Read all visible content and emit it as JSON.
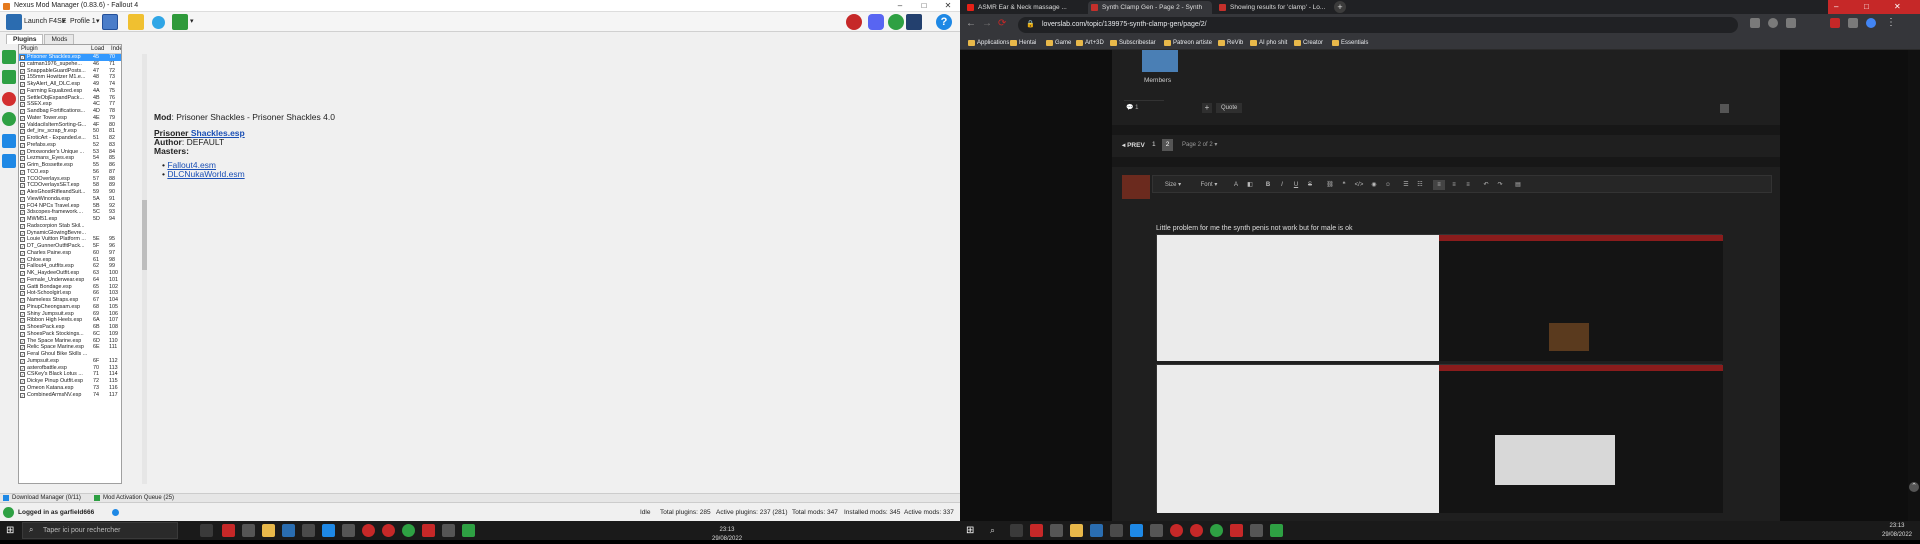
{
  "nmm": {
    "title": "Nexus Mod Manager (0.83.6) - Fallout 4",
    "toolbar": {
      "launch": "Launch F4SE",
      "profile": "Profile 1"
    },
    "tabs": [
      "Plugins",
      "Mods"
    ],
    "columns": {
      "plugin": "Plugin",
      "load_order": "Load Order",
      "index": "Index"
    },
    "plugins": [
      [
        "Prisoner Shackles.esp",
        "45",
        "70"
      ],
      [
        "catman1976_supehe...",
        "46",
        "71"
      ],
      [
        "SnappableGuardPosts...",
        "47",
        "72"
      ],
      [
        "155mm Howitzer M1.e...",
        "48",
        "73"
      ],
      [
        "SkyAlert_All_DLC.esp",
        "49",
        "74"
      ],
      [
        "Farming Equalized.esp",
        "4A",
        "75"
      ],
      [
        "SettleObjExpandPack...",
        "4B",
        "76"
      ],
      [
        "SSEX.esp",
        "4C",
        "77"
      ],
      [
        "Sandbag Fortifications...",
        "4D",
        "78"
      ],
      [
        "Water Tower.esp",
        "4E",
        "79"
      ],
      [
        "ValdacilsItemSorting-G...",
        "4F",
        "80"
      ],
      [
        "def_inv_scrap_fr.esp",
        "50",
        "81"
      ],
      [
        "EroticArt - Expanded.e...",
        "51",
        "82"
      ],
      [
        "Prefabs.esp",
        "52",
        "83"
      ],
      [
        "Dmxwonder's Unique ...",
        "53",
        "84"
      ],
      [
        "Lezmans_Eyes.esp",
        "54",
        "85"
      ],
      [
        "Grim_Bossette.esp",
        "55",
        "86"
      ],
      [
        "TCO.esp",
        "56",
        "87"
      ],
      [
        "TCOOverlays.esp",
        "57",
        "88"
      ],
      [
        "TCDOverlaysSET.esp",
        "58",
        "89"
      ],
      [
        "AlexGhostRifleandSuit...",
        "59",
        "90"
      ],
      [
        "ViewWinonda.esp",
        "5A",
        "91"
      ],
      [
        "FO4 NPCs Travel.esp",
        "5B",
        "92"
      ],
      [
        "3dscopes-framework....",
        "5C",
        "93"
      ],
      [
        "MWM51.esp",
        "5D",
        "94"
      ],
      [
        "Radscorpion Stab Skil...",
        "",
        ""
      ],
      [
        "DynamicGlowingBevre...",
        "",
        ""
      ],
      [
        "Louie Vuitton Platform ...",
        "5E",
        "95"
      ],
      [
        "DT_GunnerOutfitPack...",
        "5F",
        "96"
      ],
      [
        "Charles Paine.esp",
        "60",
        "97"
      ],
      [
        "Chloe.esp",
        "61",
        "98"
      ],
      [
        "Fallout4_outfits.esp",
        "62",
        "99"
      ],
      [
        "NK_HaydeeOutfit.esp",
        "63",
        "100"
      ],
      [
        "Female_Underwear.esp",
        "64",
        "101"
      ],
      [
        "Gatti Bondage.esp",
        "65",
        "102"
      ],
      [
        "Hot-Schoolgirl.esp",
        "66",
        "103"
      ],
      [
        "Nameless Straps.esp",
        "67",
        "104"
      ],
      [
        "PinupCheongsam.esp",
        "68",
        "105"
      ],
      [
        "Shiny Jumpsuit.esp",
        "69",
        "106"
      ],
      [
        "Ribbon High Heels.esp",
        "6A",
        "107"
      ],
      [
        "ShoesPack.esp",
        "6B",
        "108"
      ],
      [
        "ShoesPack Stockings...",
        "6C",
        "109"
      ],
      [
        "The Space Marine.esp",
        "6D",
        "110"
      ],
      [
        "Relic Space Marine.esp",
        "6E",
        "111"
      ],
      [
        "Feral Ghoul Bike Skills ...",
        "",
        ""
      ],
      [
        "Jumpsuit.esp",
        "6F",
        "112"
      ],
      [
        "asterofbattle.esp",
        "70",
        "113"
      ],
      [
        "CSKey's Black Lotus ...",
        "71",
        "114"
      ],
      [
        "Dickye Pinup Outfit.esp",
        "72",
        "115"
      ],
      [
        "Omeon Katana.esp",
        "73",
        "116"
      ],
      [
        "CombinedArmsNV.esp",
        "74",
        "117"
      ]
    ],
    "detail": {
      "mod_label": "Mod",
      "mod_value": ": Prisoner Shackles - Prisoner Shackles 4.0",
      "file_plain": "Prisoner ",
      "file_link": "Shackles.esp",
      "author_label": "Author",
      "author_value": ": DEFAULT",
      "masters_label": "Masters",
      "masters": [
        "Fallout4.esm",
        "DLCNukaWorld.esm"
      ]
    },
    "queue": {
      "download": "Download Manager (0/11)",
      "activation": "Mod Activation Queue (25)"
    },
    "status": {
      "login": "Logged in as garfield666",
      "state": "Idle",
      "total_plugins": "Total plugins: 285",
      "active_plugins": "Active plugins:  237 (281)",
      "total_mods": "Total mods: 347",
      "installed_mods": "Installed mods: 345",
      "active_mods": "Active mods: 337"
    }
  },
  "browser": {
    "tabs": [
      "ASMR Ear & Neck massage ...",
      "Synth Clamp Gen - Page 2 - Synth",
      "Showing results for 'clamp' - Lo..."
    ],
    "url": "loverslab.com/topic/139975-synth-clamp-gen/page/2/",
    "bookmarks": [
      "Applications",
      "Hentai",
      "Game",
      "Art+3D",
      "Subscribestar",
      "Patreon artiste",
      "ReVib",
      "AI pho shit",
      "Creator",
      "Essentials"
    ],
    "forum": {
      "members_label": "Members",
      "reaction_count": "1",
      "quote_btn": "Quote",
      "prev_btn": "PREV",
      "pages": [
        "1",
        "2"
      ],
      "page_of": "Page 2 of 2",
      "editor": {
        "size": "Size",
        "font": "Font"
      },
      "comment_text": "Little problem for me the synth penis not work but for male is ok"
    }
  },
  "taskbar": {
    "search_placeholder": "Taper ici pour rechercher",
    "time": "23:13",
    "date": "29/08/2022"
  }
}
